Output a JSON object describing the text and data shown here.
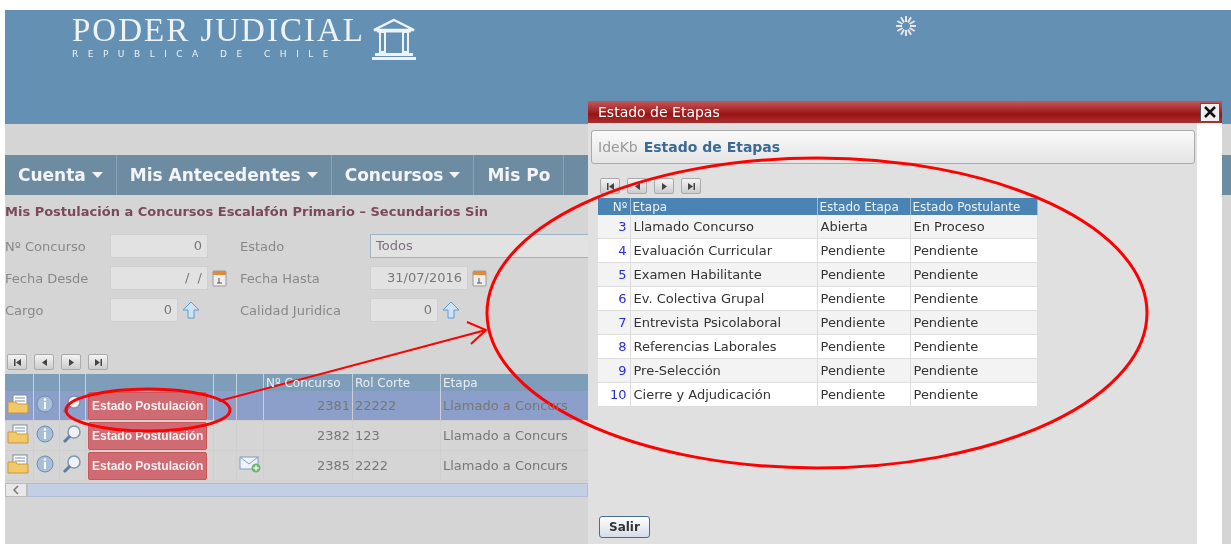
{
  "header": {
    "title": "PODER JUDICIAL",
    "subtitle": "REPUBLICA DE CHILE"
  },
  "nav": {
    "items": [
      {
        "label": "Cuenta"
      },
      {
        "label": "Mis Antecedentes"
      },
      {
        "label": "Concursos"
      },
      {
        "label": "Mis Po"
      }
    ]
  },
  "page_title": "Mis Postulación a Concursos Escalafón Primario – Secundarios Sin",
  "form": {
    "fields": [
      {
        "label": "Nº Concurso",
        "value": "0",
        "kind": "number"
      },
      {
        "label": "Estado",
        "value": "Todos",
        "kind": "select"
      },
      {
        "label": "Fecha Desde",
        "value": " /  /",
        "kind": "date"
      },
      {
        "label": "Fecha Hasta",
        "value": "31/07/2016",
        "kind": "date"
      },
      {
        "label": "Cargo",
        "value": "0",
        "kind": "lookup"
      },
      {
        "label": "Calidad Juridica",
        "value": "0",
        "kind": "lookup"
      }
    ]
  },
  "grid": {
    "columns": [
      "Nº Concurso",
      "Rol Corte",
      "Etapa"
    ],
    "rows": [
      {
        "selected": true,
        "button": "Estado Postulación",
        "mail": false,
        "concurso": "2381",
        "rol": "22222",
        "etapa": "Llamado a Concurs"
      },
      {
        "selected": false,
        "button": "Estado Postulación",
        "mail": false,
        "concurso": "2382",
        "rol": "123",
        "etapa": "Llamado a Concurs"
      },
      {
        "selected": false,
        "button": "Estado Postulación",
        "mail": true,
        "concurso": "2385",
        "rol": "2222",
        "etapa": "Llamado a Concurs"
      }
    ]
  },
  "dialog": {
    "title": "Estado de Etapas",
    "panel": {
      "prefix": "IdeKb",
      "title": "Estado de Etapas"
    },
    "table": {
      "columns": [
        "Nº",
        "Etapa",
        "Estado Etapa",
        "Estado Postulante"
      ],
      "rows": [
        {
          "n": "3",
          "etapa": "Llamado Concurso",
          "estado_etapa": "Abierta",
          "estado_postulante": "En Proceso"
        },
        {
          "n": "4",
          "etapa": "Evaluación Curricular",
          "estado_etapa": "Pendiente",
          "estado_postulante": "Pendiente"
        },
        {
          "n": "5",
          "etapa": "Examen Habilitante",
          "estado_etapa": "Pendiente",
          "estado_postulante": "Pendiente"
        },
        {
          "n": "6",
          "etapa": "Ev. Colectiva Grupal",
          "estado_etapa": "Pendiente",
          "estado_postulante": "Pendiente"
        },
        {
          "n": "7",
          "etapa": "Entrevista Psicolaboral",
          "estado_etapa": "Pendiente",
          "estado_postulante": "Pendiente"
        },
        {
          "n": "8",
          "etapa": "Referencias Laborales",
          "estado_etapa": "Pendiente",
          "estado_postulante": "Pendiente"
        },
        {
          "n": "9",
          "etapa": "Pre-Selección",
          "estado_etapa": "Pendiente",
          "estado_postulante": "Pendiente"
        },
        {
          "n": "10",
          "etapa": "Cierre y Adjudicación",
          "estado_etapa": "Pendiente",
          "estado_postulante": "Pendiente"
        }
      ]
    },
    "button": "Salir"
  }
}
